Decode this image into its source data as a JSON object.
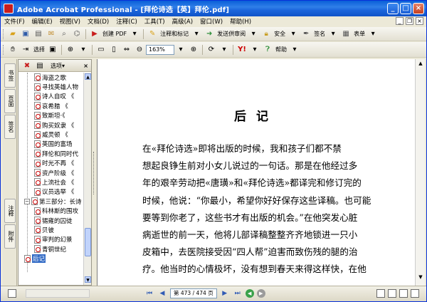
{
  "window": {
    "title": "Adobe Acrobat Professional - [拜伦诗选【英】拜伦.pdf]",
    "controls": {
      "minimize": "_",
      "maximize": "□",
      "close": "×"
    },
    "inner_controls": {
      "minimize": "_",
      "restore": "❐",
      "close": "×"
    }
  },
  "menu": [
    "文件(F)",
    "编辑(E)",
    "视图(V)",
    "文档(D)",
    "注释(C)",
    "工具(T)",
    "高级(A)",
    "窗口(W)",
    "帮助(H)"
  ],
  "toolbar1": {
    "create_pdf": "创建 PDF",
    "comment": "注释和标记",
    "send_review": "发送供审阅",
    "secure": "安全",
    "sign": "签名",
    "forms": "表单"
  },
  "toolbar2": {
    "select": "选择",
    "zoom_value": "163%",
    "help": "帮助"
  },
  "lefttabs": [
    "书签",
    "页面",
    "签名",
    "注释",
    "附件"
  ],
  "bookmarks": {
    "options_label": "选项",
    "items": [
      {
        "text": "海盗之歌",
        "level": "child"
      },
      {
        "text": "寻找英雄人物",
        "level": "child"
      },
      {
        "text": "诗人自叹 《",
        "level": "child"
      },
      {
        "text": "哀希腊 《",
        "level": "child"
      },
      {
        "text": "致斯坦·《",
        "level": "child"
      },
      {
        "text": "购买奴隶 《",
        "level": "child"
      },
      {
        "text": "威灵顿 《",
        "level": "child"
      },
      {
        "text": "英国的富场",
        "level": "child"
      },
      {
        "text": "拜伦和同时代",
        "level": "child"
      },
      {
        "text": "时光不再 《",
        "level": "child"
      },
      {
        "text": "资产阶级 《",
        "level": "child"
      },
      {
        "text": "上流社会 《",
        "level": "child"
      },
      {
        "text": "议员选举 《",
        "level": "child"
      },
      {
        "text": "第三部分：长诗",
        "level": "parent"
      },
      {
        "text": "科林斯的围攻",
        "level": "child"
      },
      {
        "text": "锡雍的囚徒",
        "level": "child"
      },
      {
        "text": "贝彼",
        "level": "child"
      },
      {
        "text": "审判的幻景",
        "level": "child"
      },
      {
        "text": "青铜世纪",
        "level": "child"
      },
      {
        "text": "后记",
        "level": "top-selected"
      }
    ]
  },
  "document": {
    "heading": "后记",
    "lines": [
      "在«拜伦诗选»即将出版的时候，我和孩子们都不禁",
      "想起良铮生前对小女儿说过的一句话。那是在他经过多",
      "年的艰辛劳动把«唐璜»和«拜伦诗选»都译完和修订完的",
      "时候，他说：“你最小，希望你好好保存这些译稿。也可能",
      "要等到你老了，这些书才有出版的机会。”在他突发心脏",
      "病逝世的前一天，他将儿部译稿整整齐齐地锁进一只小",
      "皮箱中，去医院接受因“四人帮”迫害而致伤残的腿的治",
      "疗。他当时的心情极坏，没有想到春天来得这样快，在他"
    ]
  },
  "statusbar": {
    "page_indicator": "第 473 / 474 页"
  },
  "colors": {
    "titlebar": "#0a5fd8",
    "selection": "#316ac5",
    "chrome": "#ece9d8"
  }
}
